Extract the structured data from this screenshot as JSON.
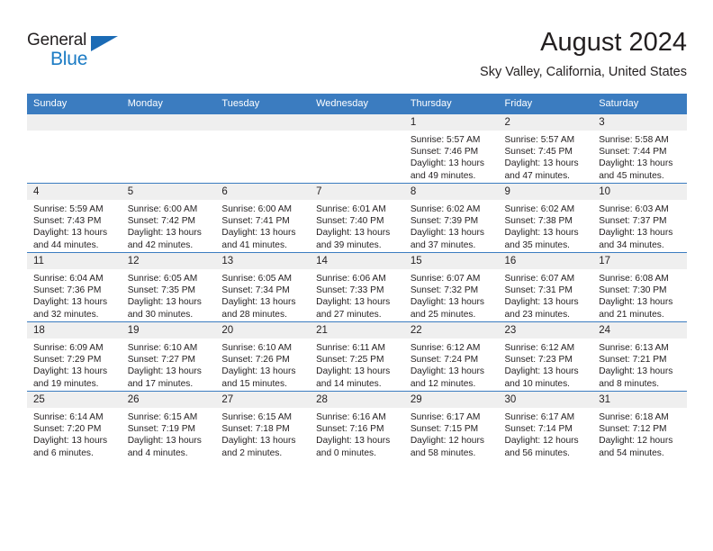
{
  "brand": {
    "name_part1": "General",
    "name_part2": "Blue",
    "triangle_color": "#1b6bb5",
    "blue_color": "#1b7bc4"
  },
  "header": {
    "title": "August 2024",
    "subtitle": "Sky Valley, California, United States",
    "accent_color": "#3b7cc0",
    "band_color": "#efefef"
  },
  "weekday_headers": [
    "Sunday",
    "Monday",
    "Tuesday",
    "Wednesday",
    "Thursday",
    "Friday",
    "Saturday"
  ],
  "weeks": [
    [
      {
        "day": "",
        "empty": true
      },
      {
        "day": "",
        "empty": true
      },
      {
        "day": "",
        "empty": true
      },
      {
        "day": "",
        "empty": true
      },
      {
        "day": "1",
        "sunrise": "Sunrise: 5:57 AM",
        "sunset": "Sunset: 7:46 PM",
        "daylight": "Daylight: 13 hours and 49 minutes."
      },
      {
        "day": "2",
        "sunrise": "Sunrise: 5:57 AM",
        "sunset": "Sunset: 7:45 PM",
        "daylight": "Daylight: 13 hours and 47 minutes."
      },
      {
        "day": "3",
        "sunrise": "Sunrise: 5:58 AM",
        "sunset": "Sunset: 7:44 PM",
        "daylight": "Daylight: 13 hours and 45 minutes."
      }
    ],
    [
      {
        "day": "4",
        "sunrise": "Sunrise: 5:59 AM",
        "sunset": "Sunset: 7:43 PM",
        "daylight": "Daylight: 13 hours and 44 minutes."
      },
      {
        "day": "5",
        "sunrise": "Sunrise: 6:00 AM",
        "sunset": "Sunset: 7:42 PM",
        "daylight": "Daylight: 13 hours and 42 minutes."
      },
      {
        "day": "6",
        "sunrise": "Sunrise: 6:00 AM",
        "sunset": "Sunset: 7:41 PM",
        "daylight": "Daylight: 13 hours and 41 minutes."
      },
      {
        "day": "7",
        "sunrise": "Sunrise: 6:01 AM",
        "sunset": "Sunset: 7:40 PM",
        "daylight": "Daylight: 13 hours and 39 minutes."
      },
      {
        "day": "8",
        "sunrise": "Sunrise: 6:02 AM",
        "sunset": "Sunset: 7:39 PM",
        "daylight": "Daylight: 13 hours and 37 minutes."
      },
      {
        "day": "9",
        "sunrise": "Sunrise: 6:02 AM",
        "sunset": "Sunset: 7:38 PM",
        "daylight": "Daylight: 13 hours and 35 minutes."
      },
      {
        "day": "10",
        "sunrise": "Sunrise: 6:03 AM",
        "sunset": "Sunset: 7:37 PM",
        "daylight": "Daylight: 13 hours and 34 minutes."
      }
    ],
    [
      {
        "day": "11",
        "sunrise": "Sunrise: 6:04 AM",
        "sunset": "Sunset: 7:36 PM",
        "daylight": "Daylight: 13 hours and 32 minutes."
      },
      {
        "day": "12",
        "sunrise": "Sunrise: 6:05 AM",
        "sunset": "Sunset: 7:35 PM",
        "daylight": "Daylight: 13 hours and 30 minutes."
      },
      {
        "day": "13",
        "sunrise": "Sunrise: 6:05 AM",
        "sunset": "Sunset: 7:34 PM",
        "daylight": "Daylight: 13 hours and 28 minutes."
      },
      {
        "day": "14",
        "sunrise": "Sunrise: 6:06 AM",
        "sunset": "Sunset: 7:33 PM",
        "daylight": "Daylight: 13 hours and 27 minutes."
      },
      {
        "day": "15",
        "sunrise": "Sunrise: 6:07 AM",
        "sunset": "Sunset: 7:32 PM",
        "daylight": "Daylight: 13 hours and 25 minutes."
      },
      {
        "day": "16",
        "sunrise": "Sunrise: 6:07 AM",
        "sunset": "Sunset: 7:31 PM",
        "daylight": "Daylight: 13 hours and 23 minutes."
      },
      {
        "day": "17",
        "sunrise": "Sunrise: 6:08 AM",
        "sunset": "Sunset: 7:30 PM",
        "daylight": "Daylight: 13 hours and 21 minutes."
      }
    ],
    [
      {
        "day": "18",
        "sunrise": "Sunrise: 6:09 AM",
        "sunset": "Sunset: 7:29 PM",
        "daylight": "Daylight: 13 hours and 19 minutes."
      },
      {
        "day": "19",
        "sunrise": "Sunrise: 6:10 AM",
        "sunset": "Sunset: 7:27 PM",
        "daylight": "Daylight: 13 hours and 17 minutes."
      },
      {
        "day": "20",
        "sunrise": "Sunrise: 6:10 AM",
        "sunset": "Sunset: 7:26 PM",
        "daylight": "Daylight: 13 hours and 15 minutes."
      },
      {
        "day": "21",
        "sunrise": "Sunrise: 6:11 AM",
        "sunset": "Sunset: 7:25 PM",
        "daylight": "Daylight: 13 hours and 14 minutes."
      },
      {
        "day": "22",
        "sunrise": "Sunrise: 6:12 AM",
        "sunset": "Sunset: 7:24 PM",
        "daylight": "Daylight: 13 hours and 12 minutes."
      },
      {
        "day": "23",
        "sunrise": "Sunrise: 6:12 AM",
        "sunset": "Sunset: 7:23 PM",
        "daylight": "Daylight: 13 hours and 10 minutes."
      },
      {
        "day": "24",
        "sunrise": "Sunrise: 6:13 AM",
        "sunset": "Sunset: 7:21 PM",
        "daylight": "Daylight: 13 hours and 8 minutes."
      }
    ],
    [
      {
        "day": "25",
        "sunrise": "Sunrise: 6:14 AM",
        "sunset": "Sunset: 7:20 PM",
        "daylight": "Daylight: 13 hours and 6 minutes."
      },
      {
        "day": "26",
        "sunrise": "Sunrise: 6:15 AM",
        "sunset": "Sunset: 7:19 PM",
        "daylight": "Daylight: 13 hours and 4 minutes."
      },
      {
        "day": "27",
        "sunrise": "Sunrise: 6:15 AM",
        "sunset": "Sunset: 7:18 PM",
        "daylight": "Daylight: 13 hours and 2 minutes."
      },
      {
        "day": "28",
        "sunrise": "Sunrise: 6:16 AM",
        "sunset": "Sunset: 7:16 PM",
        "daylight": "Daylight: 13 hours and 0 minutes."
      },
      {
        "day": "29",
        "sunrise": "Sunrise: 6:17 AM",
        "sunset": "Sunset: 7:15 PM",
        "daylight": "Daylight: 12 hours and 58 minutes."
      },
      {
        "day": "30",
        "sunrise": "Sunrise: 6:17 AM",
        "sunset": "Sunset: 7:14 PM",
        "daylight": "Daylight: 12 hours and 56 minutes."
      },
      {
        "day": "31",
        "sunrise": "Sunrise: 6:18 AM",
        "sunset": "Sunset: 7:12 PM",
        "daylight": "Daylight: 12 hours and 54 minutes."
      }
    ]
  ]
}
